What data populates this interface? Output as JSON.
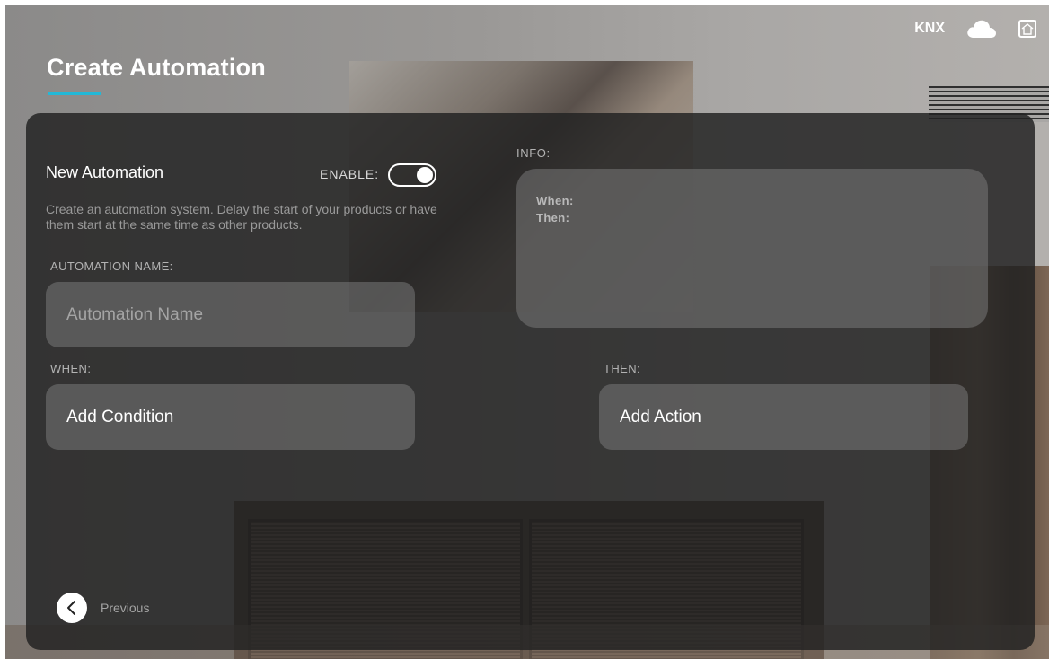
{
  "header": {
    "title": "Create Automation",
    "knx_label": "KNX",
    "icons": [
      "cloud-icon",
      "home-icon"
    ],
    "accent_color": "#23b8d7"
  },
  "form": {
    "section_title": "New Automation",
    "enable_label": "ENABLE:",
    "enabled": true,
    "description": "Create an automation system. Delay the start of your products or have them start at the same time as other products.",
    "name_label": "AUTOMATION NAME:",
    "name_value": "",
    "name_placeholder": "Automation Name",
    "when_label": "WHEN:",
    "when_button": "Add Condition",
    "then_label": "THEN:",
    "then_button": "Add Action"
  },
  "info": {
    "label": "INFO:",
    "when_line": "When:",
    "then_line": "Then:"
  },
  "navigation": {
    "previous_label": "Previous",
    "previous_icon": "chevron-left-icon"
  }
}
